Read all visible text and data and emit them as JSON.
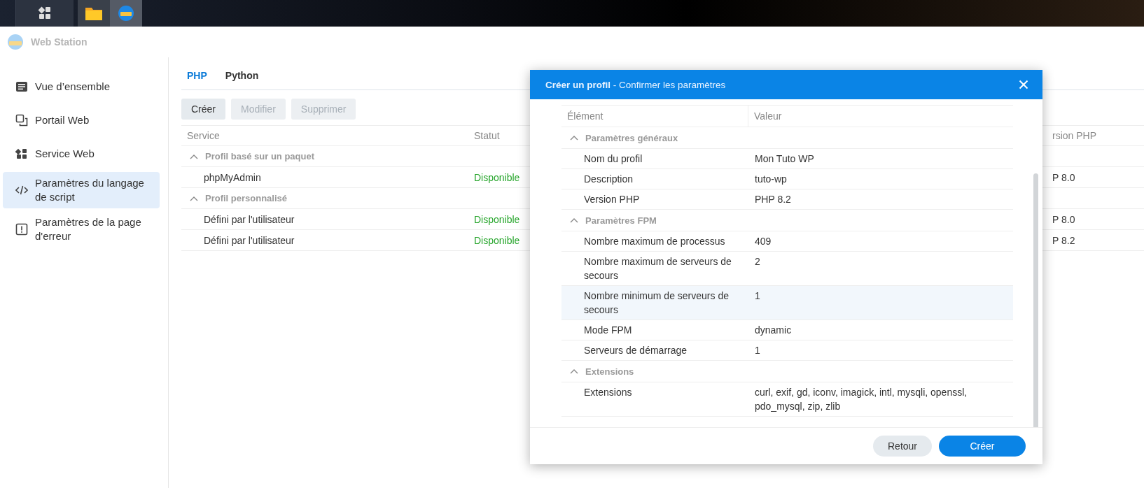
{
  "app": {
    "title": "Web Station"
  },
  "sidebar": {
    "items": [
      {
        "label": "Vue d’ensemble",
        "selected": false
      },
      {
        "label": "Portail Web",
        "selected": false
      },
      {
        "label": "Service Web",
        "selected": false
      },
      {
        "label": "Paramètres du langage de script",
        "selected": true
      },
      {
        "label": "Paramètres de la page d'erreur",
        "selected": false
      }
    ]
  },
  "tabs": [
    {
      "label": "PHP",
      "selected": true
    },
    {
      "label": "Python",
      "selected": false
    }
  ],
  "toolbar": {
    "buttons": [
      {
        "label": "Créer",
        "disabled": false
      },
      {
        "label": "Modifier",
        "disabled": true
      },
      {
        "label": "Supprimer",
        "disabled": true
      }
    ]
  },
  "table": {
    "columns": [
      "Service",
      "Statut",
      "rsion PHP"
    ],
    "groups": [
      {
        "label": "Profil basé sur un paquet",
        "expanded": true,
        "rows": [
          {
            "service": "phpMyAdmin",
            "status": "Disponible",
            "version": "P 8.0"
          }
        ]
      },
      {
        "label": "Profil personnalisé",
        "expanded": true,
        "rows": [
          {
            "service": "Défini par l'utilisateur",
            "status": "Disponible",
            "version": "P 8.0"
          },
          {
            "service": "Défini par l'utilisateur",
            "status": "Disponible",
            "version": "P 8.2"
          }
        ]
      }
    ]
  },
  "dialog": {
    "title": "**Créer un profil** - Confirmer les paramètres",
    "columns": [
      "Élément",
      "Valeur"
    ],
    "groups": [
      {
        "label": "Paramètres généraux",
        "expanded": true,
        "rows": [
          {
            "element": "Nom du profil",
            "value": "Mon Tuto WP",
            "hovered": false
          },
          {
            "element": "Description",
            "value": "tuto-wp",
            "hovered": false
          },
          {
            "element": "Version PHP",
            "value": "PHP 8.2",
            "hovered": false
          }
        ]
      },
      {
        "label": "Paramètres FPM",
        "expanded": true,
        "rows": [
          {
            "element": "Nombre maximum de processus",
            "value": "409",
            "hovered": false
          },
          {
            "element": "Nombre maximum de serveurs de secours",
            "value": "2",
            "hovered": false
          },
          {
            "element": "Nombre minimum de serveurs de secours",
            "value": "1",
            "hovered": true
          },
          {
            "element": "Mode FPM",
            "value": "dynamic",
            "hovered": false
          },
          {
            "element": "Serveurs de démarrage",
            "value": "1",
            "hovered": false
          }
        ]
      },
      {
        "label": "Extensions",
        "expanded": true,
        "rows": [
          {
            "element": "Extensions",
            "value": "curl, exif, gd, iconv, imagick, intl, mysqli, openssl, pdo_mysql, zip, zlib",
            "hovered": false
          }
        ]
      }
    ],
    "buttons": [
      {
        "label": "Retour",
        "kind": "secondary"
      },
      {
        "label": "Créer",
        "kind": "primary"
      }
    ]
  }
}
